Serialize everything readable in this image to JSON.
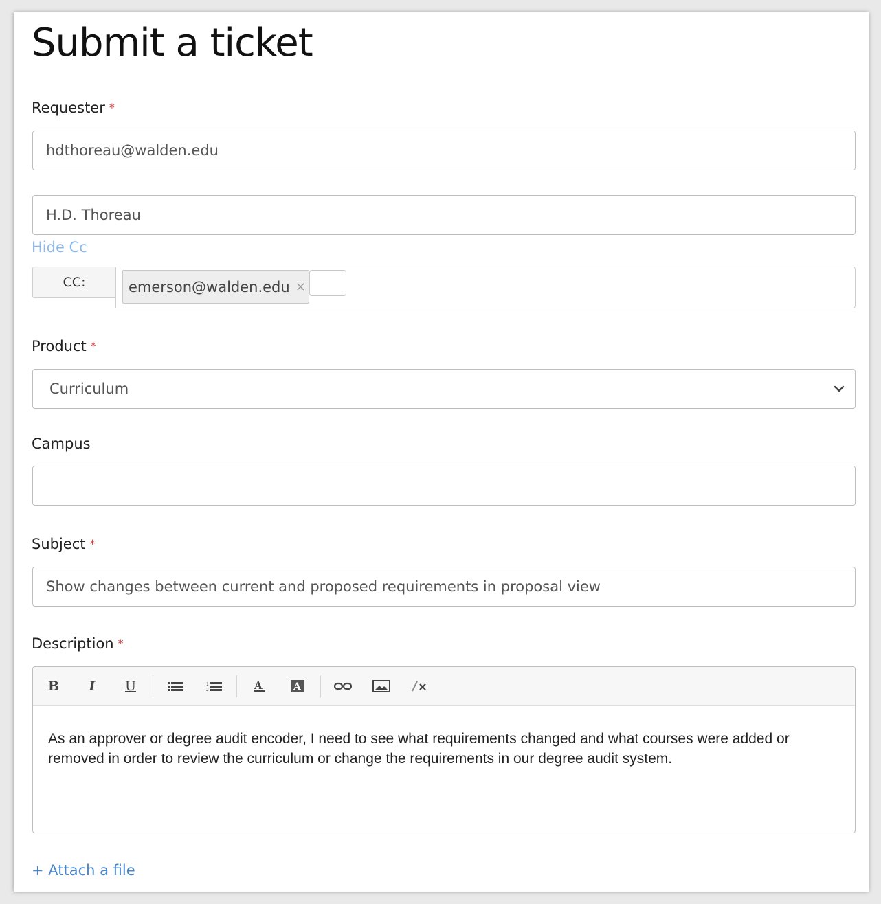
{
  "page": {
    "title": "Submit a ticket"
  },
  "requester": {
    "label": "Requester",
    "required_mark": "*",
    "email_value": "hdthoreau@walden.edu",
    "name_value": "H.D. Thoreau",
    "hide_cc_link": "Hide Cc"
  },
  "cc": {
    "label": "CC:",
    "chips": [
      {
        "email": "emerson@walden.edu",
        "remove": "×"
      }
    ]
  },
  "product": {
    "label": "Product",
    "required_mark": "*",
    "selected": "Curriculum"
  },
  "campus": {
    "label": "Campus",
    "value": ""
  },
  "subject": {
    "label": "Subject",
    "required_mark": "*",
    "value": "Show changes between current and proposed requirements in proposal view"
  },
  "description": {
    "label": "Description",
    "required_mark": "*",
    "toolbar": {
      "bold": "B",
      "italic": "I",
      "underline": "U",
      "icons": [
        "bulleted-list-icon",
        "numbered-list-icon",
        "text-color-icon",
        "background-color-icon",
        "link-icon",
        "image-icon",
        "clear-formatting-icon"
      ]
    },
    "body": "As an approver or degree audit encoder, I need to see what requirements changed and what courses were added or removed in order to review the curriculum or change the requirements in our degree audit system."
  },
  "attach": {
    "label": "+ Attach a file"
  },
  "colors": {
    "link": "#8fb7e8",
    "attach_link": "#4a86c8",
    "required": "#d33a3a"
  }
}
